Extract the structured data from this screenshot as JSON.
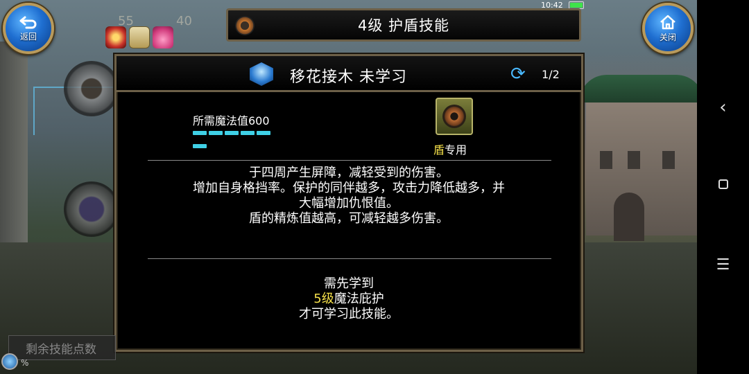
{
  "status": {
    "time": "10:42"
  },
  "topbar": {
    "back_label": "返回",
    "close_label": "关闭",
    "title": "4级 护盾技能"
  },
  "background": {
    "num_left": "55",
    "num_right": "40"
  },
  "skill": {
    "name_status": "移花接木 未学习",
    "page_indicator": "1/2",
    "mp_requirement": "所需魔法值600",
    "mp_segments": 6,
    "equip_marker": "盾",
    "equip_suffix": "专用",
    "description": [
      "于四周产生屏障，减轻受到的伤害。",
      "增加自身格挡率。保护的同伴越多，攻击力降低越多，并",
      "大幅增加仇恨值。",
      "盾的精炼值越高，可减轻越多伤害。"
    ],
    "requirement": {
      "line1": "需先学到",
      "level": "5级",
      "skill": "魔法庇护",
      "line3": "才可学习此技能。"
    }
  },
  "points": {
    "label": "剩余技能点数",
    "pct": "%"
  },
  "nav": {
    "back": "‹",
    "menu": "☰"
  },
  "colors": {
    "accent": "#f5e04a",
    "frame": "#6d6048",
    "mp_bar": "#3fd0e6",
    "button_blue": "#1f6fd1"
  },
  "icons": [
    "back-arrow-icon",
    "home-icon",
    "gear-icon",
    "medal-icon",
    "mail-icon",
    "gift-icon",
    "skill-emblem-icon",
    "swap-icon",
    "shield-icon"
  ]
}
